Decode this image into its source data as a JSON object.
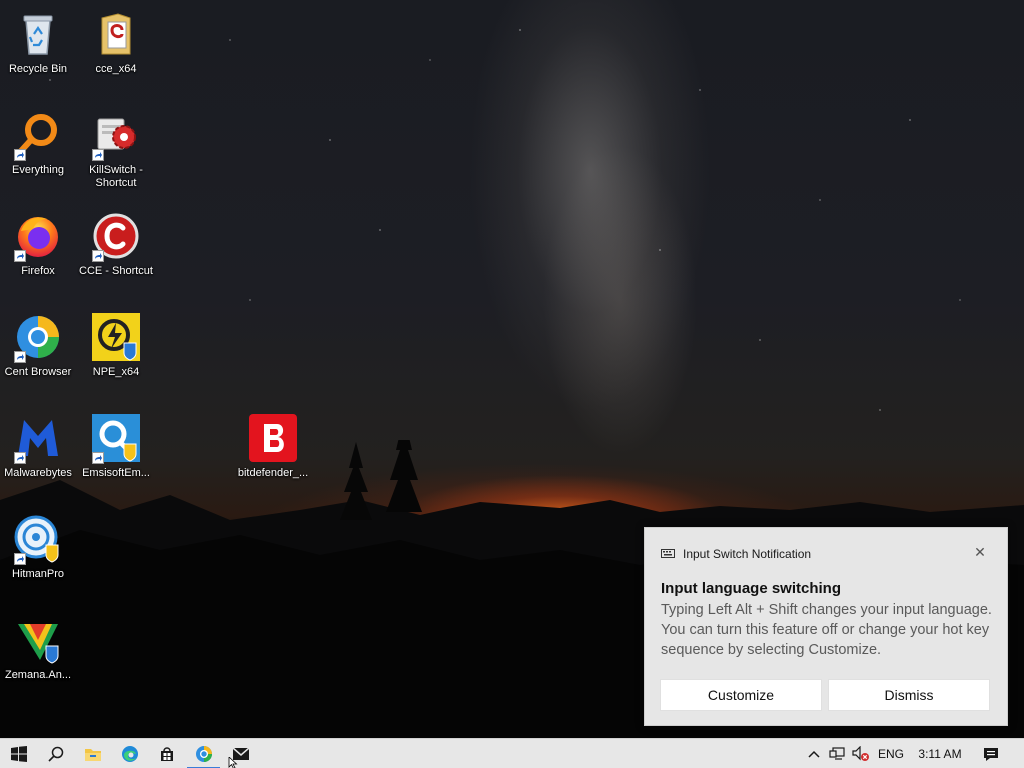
{
  "desktop": {
    "icons": [
      {
        "label": "Recycle Bin",
        "icon": "recycle-bin-icon"
      },
      {
        "label": "cce_x64",
        "icon": "folder-icon"
      },
      {
        "label": "Everything",
        "icon": "everything-search-icon"
      },
      {
        "label": "KillSwitch -\nShortcut",
        "icon": "killswitch-icon"
      },
      {
        "label": "Firefox",
        "icon": "firefox-icon"
      },
      {
        "label": "CCE - Shortcut",
        "icon": "comodo-cleaning-essentials-icon"
      },
      {
        "label": "Cent Browser",
        "icon": "cent-browser-icon"
      },
      {
        "label": "NPE_x64",
        "icon": "norton-power-eraser-icon"
      },
      {
        "label": "Malwarebytes",
        "icon": "malwarebytes-icon"
      },
      {
        "label": "EmsisoftEm...",
        "icon": "emsisoft-icon"
      },
      {
        "label": "bitdefender_...",
        "icon": "bitdefender-icon"
      },
      {
        "label": "HitmanPro",
        "icon": "hitmanpro-icon"
      },
      {
        "label": "Zemana.An...",
        "icon": "zemana-icon"
      }
    ]
  },
  "notification": {
    "app_name": "Input Switch Notification",
    "title": "Input language switching",
    "body": "Typing Left Alt + Shift changes your input language. You can turn this feature off or change your hot key sequence by selecting Customize.",
    "customize_label": "Customize",
    "dismiss_label": "Dismiss",
    "close_glyph": "✕"
  },
  "taskbar": {
    "pinned": [
      "windows-start-icon",
      "search-icon",
      "file-explorer-icon",
      "edge-icon",
      "microsoft-store-icon",
      "cent-browser-icon",
      "mail-icon"
    ],
    "tray": {
      "language": "ENG",
      "time": "3:11 AM"
    },
    "accent": "#3b7dd8"
  }
}
